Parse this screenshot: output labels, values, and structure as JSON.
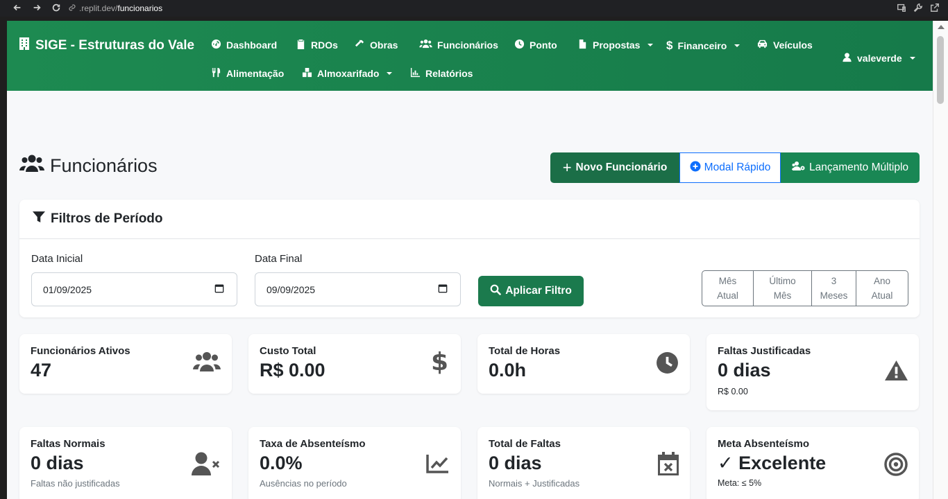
{
  "browser": {
    "url_host": ".replit.dev/",
    "url_path": "funcionarios"
  },
  "navbar": {
    "brand": "SIGE - Estruturas do Vale",
    "items": [
      {
        "label": "Dashboard",
        "icon": "dashboard-icon"
      },
      {
        "label": "RDOs",
        "icon": "clipboard-icon"
      },
      {
        "label": "Obras",
        "icon": "hammer-icon"
      },
      {
        "label": "Funcionários",
        "icon": "users-icon"
      },
      {
        "label": "Ponto",
        "icon": "clock-icon"
      },
      {
        "label": "Propostas",
        "icon": "file-icon",
        "dropdown": true
      },
      {
        "label": "Financeiro",
        "icon": "dollar-icon",
        "dropdown": true
      },
      {
        "label": "Veículos",
        "icon": "car-icon"
      },
      {
        "label": "Alimentação",
        "icon": "utensils-icon"
      },
      {
        "label": "Almoxarifado",
        "icon": "boxes-icon",
        "dropdown": true
      },
      {
        "label": "Relatórios",
        "icon": "chart-icon"
      }
    ],
    "user": "valeverde"
  },
  "page": {
    "title": "Funcionários",
    "buttons": {
      "new": "Novo Funcionário",
      "modal": "Modal Rápido",
      "multi": "Lançamento Múltiplo"
    }
  },
  "filters": {
    "title": "Filtros de Período",
    "start_label": "Data Inicial",
    "start_value": "01/09/2025",
    "end_label": "Data Final",
    "end_value": "09/09/2025",
    "apply": "Aplicar Filtro",
    "periods": [
      [
        "Mês",
        "Atual"
      ],
      [
        "Último",
        "Mês"
      ],
      [
        "3",
        "Meses"
      ],
      [
        "Ano",
        "Atual"
      ]
    ]
  },
  "stats": [
    {
      "label": "Funcionários Ativos",
      "value": "47",
      "sub": "",
      "icon": "users-icon"
    },
    {
      "label": "Custo Total",
      "value": "R$ 0.00",
      "sub": "",
      "icon": "dollar-icon"
    },
    {
      "label": "Total de Horas",
      "value": "0.0h",
      "sub": "",
      "icon": "clock-icon"
    },
    {
      "label": "Faltas Justificadas",
      "value": "0 dias",
      "sub": "R$ 0.00",
      "icon": "warning-icon"
    },
    {
      "label": "Faltas Normais",
      "value": "0 dias",
      "sub": "Faltas não justificadas",
      "icon": "user-x-icon"
    },
    {
      "label": "Taxa de Absenteísmo",
      "value": "0.0%",
      "sub": "Ausências no período",
      "icon": "line-chart-icon"
    },
    {
      "label": "Total de Faltas",
      "value": "0 dias",
      "sub": "Normais + Justificadas",
      "icon": "calendar-x-icon"
    },
    {
      "label": "Meta Absenteísmo",
      "value": "✓ Excelente",
      "sub": "Meta: ≤ 5%",
      "icon": "target-icon"
    }
  ]
}
